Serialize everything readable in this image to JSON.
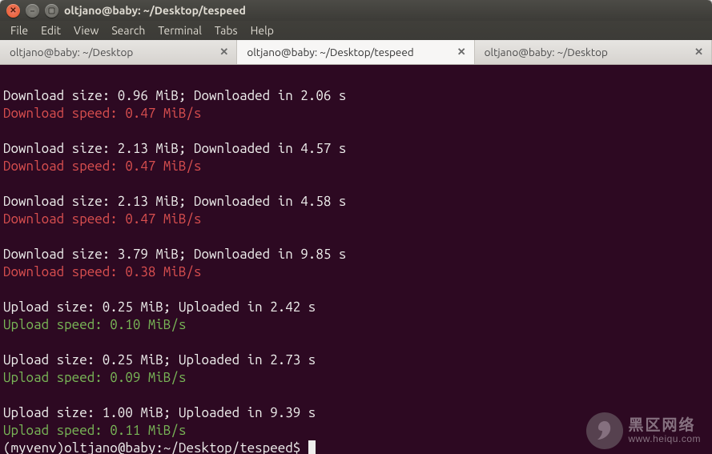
{
  "titlebar": {
    "title": "oltjano@baby: ~/Desktop/tespeed"
  },
  "menubar": {
    "items": [
      "File",
      "Edit",
      "View",
      "Search",
      "Terminal",
      "Tabs",
      "Help"
    ]
  },
  "tabs": [
    {
      "label": "oltjano@baby: ~/Desktop",
      "active": false
    },
    {
      "label": "oltjano@baby: ~/Desktop/tespeed",
      "active": true
    },
    {
      "label": "oltjano@baby: ~/Desktop",
      "active": false
    }
  ],
  "terminal": {
    "blocks": [
      {
        "info": "Download size: 0.96 MiB; Downloaded in 2.06 s",
        "speed": "Download speed: 0.47 MiB/s",
        "class": "red"
      },
      {
        "info": "Download size: 2.13 MiB; Downloaded in 4.57 s",
        "speed": "Download speed: 0.47 MiB/s",
        "class": "red"
      },
      {
        "info": "Download size: 2.13 MiB; Downloaded in 4.58 s",
        "speed": "Download speed: 0.47 MiB/s",
        "class": "red"
      },
      {
        "info": "Download size: 3.79 MiB; Downloaded in 9.85 s",
        "speed": "Download speed: 0.38 MiB/s",
        "class": "red"
      },
      {
        "info": "Upload size: 0.25 MiB; Uploaded in 2.42 s",
        "speed": "Upload speed: 0.10 MiB/s",
        "class": "green"
      },
      {
        "info": "Upload size: 0.25 MiB; Uploaded in 2.73 s",
        "speed": "Upload speed: 0.09 MiB/s",
        "class": "green"
      },
      {
        "info": "Upload size: 1.00 MiB; Uploaded in 9.39 s",
        "speed": "Upload speed: 0.11 MiB/s",
        "class": "green"
      }
    ],
    "prompt": "(myvenv)oltjano@baby:~/Desktop/tespeed$ "
  },
  "watermark": {
    "line1": "黑区网络",
    "line2": "www.heiqu.com"
  }
}
